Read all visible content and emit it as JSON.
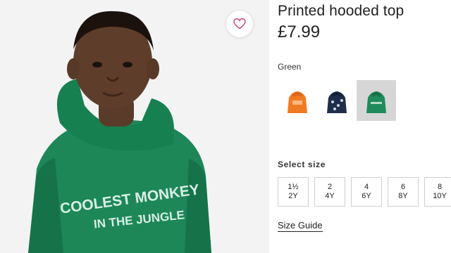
{
  "product": {
    "title": "Printed hooded top",
    "price": "£7.99",
    "hoodie_print_line1": "COOLEST MONKEY",
    "hoodie_print_line2": "IN THE JUNGLE"
  },
  "color": {
    "label": "Green",
    "swatches": [
      {
        "name": "orange",
        "hex": "#f07a22",
        "selected": false
      },
      {
        "name": "navy",
        "hex": "#1f2e4a",
        "selected": false
      },
      {
        "name": "green",
        "hex": "#1f8a5b",
        "selected": true
      }
    ]
  },
  "size": {
    "label": "Select size",
    "options": [
      {
        "top": "1½",
        "bottom": "2Y"
      },
      {
        "top": "2",
        "bottom": "4Y"
      },
      {
        "top": "4",
        "bottom": "6Y"
      },
      {
        "top": "6",
        "bottom": "8Y"
      },
      {
        "top": "8",
        "bottom": "10Y"
      }
    ]
  },
  "size_guide": {
    "label": "Size Guide"
  },
  "colors": {
    "hoodie": "#1f8a5b",
    "heart": "#c9456b"
  },
  "icons": {
    "favorite": "heart-icon"
  }
}
